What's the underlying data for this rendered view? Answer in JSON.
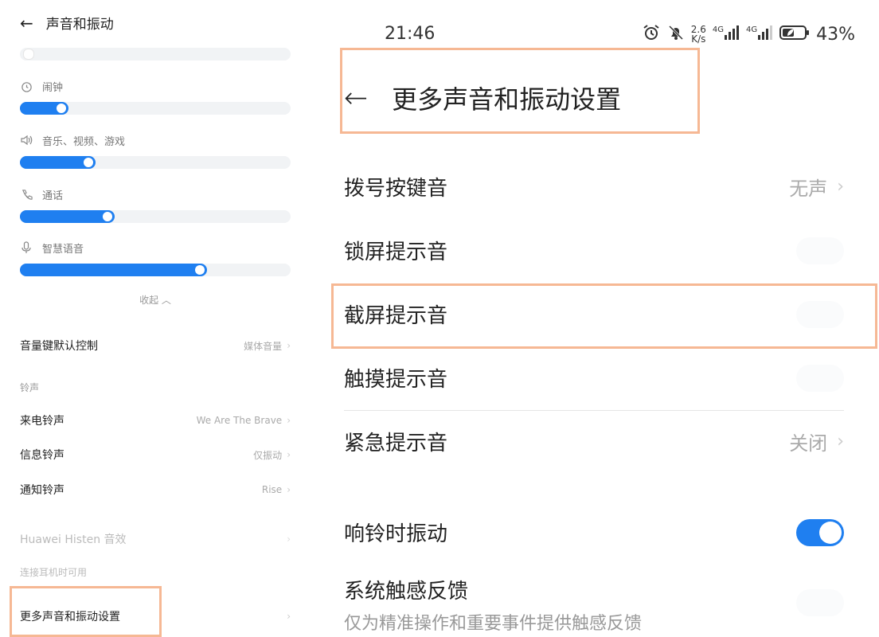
{
  "left": {
    "header": {
      "back_icon": "←",
      "title": "声音和振动"
    },
    "volumes": [
      {
        "icon": "alarm-icon",
        "label": "闹钟",
        "level": 0.18
      },
      {
        "icon": "speaker-icon",
        "label": "音乐、视频、游戏",
        "level": 0.28
      },
      {
        "icon": "phone-icon",
        "label": "通话",
        "level": 0.35
      },
      {
        "icon": "mic-icon",
        "label": "智慧语音",
        "level": 0.69
      }
    ],
    "collapse_label": "收起 ︿",
    "volume_key": {
      "label": "音量键默认控制",
      "value": "媒体音量"
    },
    "ringtone_section": "铃声",
    "ringtones": [
      {
        "label": "来电铃声",
        "value": "We Are The Brave"
      },
      {
        "label": "信息铃声",
        "value": "仅振动"
      },
      {
        "label": "通知铃声",
        "value": "Rise"
      }
    ],
    "histen": {
      "label": "Huawei Histen 音效"
    },
    "headphone_note": "连接耳机时可用",
    "more_settings": {
      "label": "更多声音和振动设置"
    },
    "chevron": "›"
  },
  "right": {
    "status": {
      "time": "21:46",
      "speed_top": "2.6",
      "speed_bottom": "K/s",
      "net1": "4G",
      "net2": "4G",
      "battery": "43%"
    },
    "title": {
      "back_icon": "←",
      "text": "更多声音和振动设置"
    },
    "rows": [
      {
        "label": "拨号按键音",
        "value": "无声"
      },
      {
        "label": "锁屏提示音",
        "toggle": false
      },
      {
        "label": "截屏提示音",
        "toggle": false
      },
      {
        "label": "触摸提示音",
        "toggle": false
      },
      {
        "label": "紧急提示音",
        "value": "关闭"
      },
      {
        "label": "响铃时振动",
        "toggle": true
      },
      {
        "label": "系统触感反馈",
        "toggle": false,
        "subtitle": "仅为精准操作和重要事件提供触感反馈"
      }
    ],
    "chevron": "›"
  },
  "colors": {
    "accent": "#1f7ff0",
    "highlight": "#f6b894"
  }
}
